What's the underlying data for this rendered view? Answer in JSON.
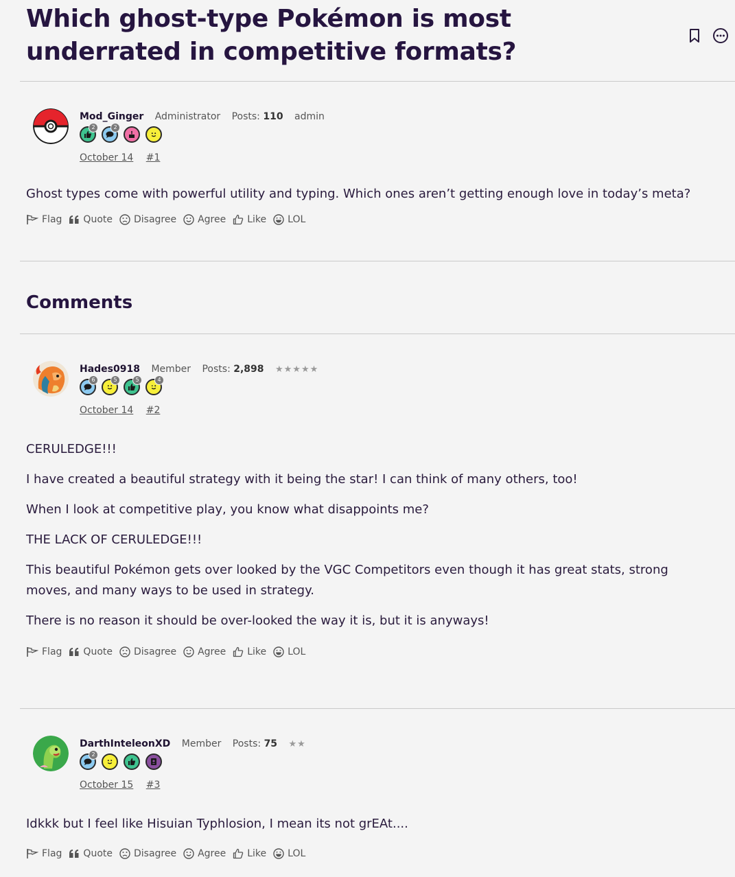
{
  "page": {
    "title": "Which ghost-type Pokémon is most underrated in competitive formats?",
    "comments_heading": "Comments"
  },
  "reaction_labels": {
    "flag": "Flag",
    "quote": "Quote",
    "disagree": "Disagree",
    "agree": "Agree",
    "like": "Like",
    "lol": "LOL"
  },
  "posts": [
    {
      "author": "Mod_Ginger",
      "role": "Administrator",
      "posts_label": "Posts:",
      "posts_count": "110",
      "extra": "admin",
      "stars": "",
      "date": "October 14",
      "number": "#1",
      "badges": [
        {
          "icon": "thumbs-up-badge",
          "color": "#3ec38f",
          "count": "2"
        },
        {
          "icon": "comment-badge",
          "color": "#8ccaf0",
          "count": "2"
        },
        {
          "icon": "cake-badge",
          "color": "#f06fa5",
          "count": ""
        },
        {
          "icon": "smile-badge",
          "color": "#f7ef3a",
          "count": ""
        }
      ],
      "paragraphs": [
        "Ghost types come with powerful utility and typing. Which ones aren’t getting enough love in today’s meta?"
      ]
    },
    {
      "author": "Hades0918",
      "role": "Member",
      "posts_label": "Posts:",
      "posts_count": "2,898",
      "extra": "",
      "stars": "★★★★★",
      "date": "October 14",
      "number": "#2",
      "badges": [
        {
          "icon": "comment-badge",
          "color": "#8ccaf0",
          "count": "6"
        },
        {
          "icon": "smile-badge",
          "color": "#f7ef3a",
          "count": "5"
        },
        {
          "icon": "thumbs-up-badge",
          "color": "#3ec38f",
          "count": "5"
        },
        {
          "icon": "wink-badge",
          "color": "#f7ef3a",
          "count": "4"
        }
      ],
      "paragraphs": [
        "CERULEDGE!!!",
        "I have created a beautiful strategy with it being the star! I can think of many others, too!",
        "When I look at competitive play, you know what disappoints me?",
        "THE LACK OF CERULEDGE!!!",
        "This beautiful Pokémon gets over looked by the VGC Competitors even though it has great stats, strong moves, and many ways to be used in strategy.",
        "There is no reason it should be over-looked the way it is, but it is anyways!"
      ]
    },
    {
      "author": "DarthInteleonXD",
      "role": "Member",
      "posts_label": "Posts:",
      "posts_count": "75",
      "extra": "",
      "stars": "★★",
      "date": "October 15",
      "number": "#3",
      "badges": [
        {
          "icon": "comment-badge",
          "color": "#8ccaf0",
          "count": "2"
        },
        {
          "icon": "smile-badge",
          "color": "#f7ef3a",
          "count": ""
        },
        {
          "icon": "thumbs-up-badge",
          "color": "#3ec38f",
          "count": ""
        },
        {
          "icon": "address-book-badge",
          "color": "#8a4f9e",
          "count": ""
        }
      ],
      "paragraphs": [
        "Idkkk but I feel like Hisuian Typhlosion, I mean its not grEAt...."
      ]
    }
  ]
}
